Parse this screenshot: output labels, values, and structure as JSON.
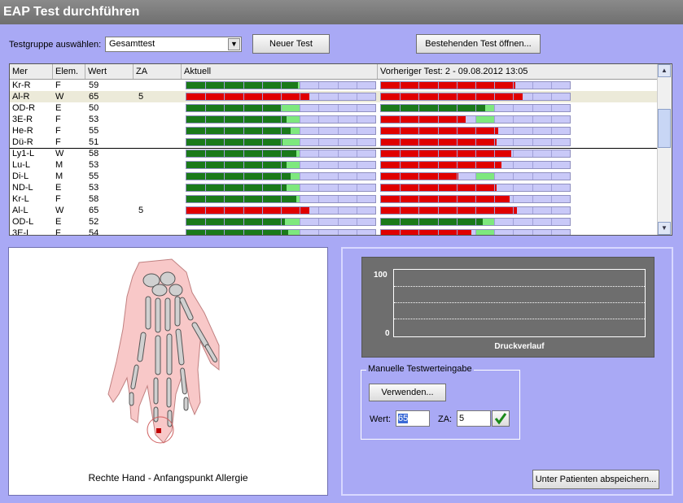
{
  "window": {
    "title": "EAP Test durchführen"
  },
  "toolbar": {
    "group_label": "Testgruppe auswählen:",
    "group_value": "Gesamttest",
    "new_test": "Neuer Test",
    "open_test": "Bestehenden Test öffnen..."
  },
  "grid": {
    "columns": [
      "Mer",
      "Elem.",
      "Wert",
      "ZA",
      "Aktuell",
      "Vorheriger Test: 2 - 09.08.2012 13:05"
    ],
    "rows": [
      {
        "mer": "Kr-R",
        "elem": "F",
        "wert": "59",
        "za": "",
        "cur": 59,
        "curColor": "green",
        "prev": 71,
        "prevColor": "red"
      },
      {
        "mer": "Al-R",
        "elem": "W",
        "wert": "65",
        "za": "5",
        "cur": 65,
        "curColor": "red",
        "prev": 75,
        "prevColor": "red",
        "selected": true
      },
      {
        "mer": "OD-R",
        "elem": "E",
        "wert": "50",
        "za": "",
        "cur": 50,
        "curColor": "green",
        "prev": 55,
        "prevColor": "green"
      },
      {
        "mer": "3E-R",
        "elem": "F",
        "wert": "53",
        "za": "",
        "cur": 53,
        "curColor": "green",
        "prev": 45,
        "prevColor": "red"
      },
      {
        "mer": "He-R",
        "elem": "F",
        "wert": "55",
        "za": "",
        "cur": 55,
        "curColor": "green",
        "prev": 62,
        "prevColor": "red"
      },
      {
        "mer": "Dü-R",
        "elem": "F",
        "wert": "51",
        "za": "",
        "cur": 51,
        "curColor": "green",
        "prev": 61,
        "prevColor": "red"
      },
      {
        "mer": "Ly1-L",
        "elem": "W",
        "wert": "58",
        "za": "",
        "cur": 58,
        "curColor": "green",
        "prev": 69,
        "prevColor": "red",
        "sep": true
      },
      {
        "mer": "Lu-L",
        "elem": "M",
        "wert": "53",
        "za": "",
        "cur": 53,
        "curColor": "green",
        "prev": 64,
        "prevColor": "red"
      },
      {
        "mer": "Di-L",
        "elem": "M",
        "wert": "55",
        "za": "",
        "cur": 55,
        "curColor": "green",
        "prev": 41,
        "prevColor": "red"
      },
      {
        "mer": "ND-L",
        "elem": "E",
        "wert": "53",
        "za": "",
        "cur": 53,
        "curColor": "green",
        "prev": 61,
        "prevColor": "red"
      },
      {
        "mer": "Kr-L",
        "elem": "F",
        "wert": "58",
        "za": "",
        "cur": 58,
        "curColor": "green",
        "prev": 68,
        "prevColor": "red"
      },
      {
        "mer": "Al-L",
        "elem": "W",
        "wert": "65",
        "za": "5",
        "cur": 65,
        "curColor": "red",
        "prev": 72,
        "prevColor": "red"
      },
      {
        "mer": "OD-L",
        "elem": "E",
        "wert": "52",
        "za": "",
        "cur": 52,
        "curColor": "green",
        "prev": 54,
        "prevColor": "green"
      },
      {
        "mer": "3E-L",
        "elem": "F",
        "wert": "54",
        "za": "",
        "cur": 54,
        "curColor": "green",
        "prev": 48,
        "prevColor": "red"
      }
    ]
  },
  "hand": {
    "caption": "Rechte Hand - Anfangspunkt Allergie"
  },
  "pressure": {
    "ymax": "100",
    "ymin": "0",
    "xlabel": "Druckverlauf"
  },
  "manual": {
    "legend": "Manuelle Testwerteingabe",
    "use_button": "Verwenden...",
    "wert_label": "Wert:",
    "wert_value": "65",
    "za_label": "ZA:",
    "za_value": "5"
  },
  "save_button": "Unter Patienten abspeichern...",
  "colors": {
    "green": "#1a7a1a",
    "red": "#e00000",
    "lightgreen": "#7ee87e",
    "barbg": "#c9c9f8"
  }
}
